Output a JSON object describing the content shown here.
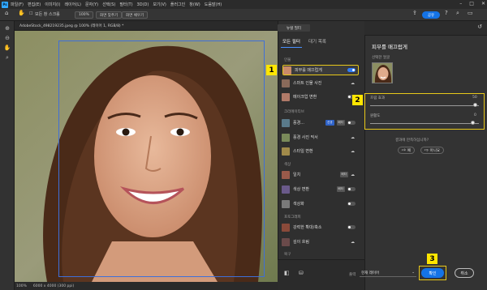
{
  "app": {
    "logo": "Ps",
    "menus": [
      "파일(F)",
      "편집(E)",
      "이미지(I)",
      "레이어(L)",
      "문자(Y)",
      "선택(S)",
      "필터(T)",
      "3D(D)",
      "보기(V)",
      "플러그인",
      "창(W)",
      "도움말(H)"
    ],
    "window_controls": [
      "–",
      "□",
      "✕"
    ]
  },
  "options_bar": {
    "scroll_all_label": "모든 창 스크롤",
    "zoom_value": "100%",
    "fit_screen_label": "화면 맞추기",
    "fill_screen_label": "화면 채우기",
    "share_label": "공유"
  },
  "document": {
    "tab_title": "AdobeStock_498219235.jpeg @ 100% (레이어 1, RGB/8) *"
  },
  "status": {
    "zoom": "100%",
    "info": "6000 x 4000 (300 ppi)"
  },
  "neural_filters": {
    "panel_title": "뉴럴 필터",
    "tabs": [
      "모든 필터",
      "대기 목록"
    ],
    "sections": {
      "portrait": "인물",
      "creative": "크리에이티브",
      "color": "색상",
      "photography": "포토그래피",
      "restoration": "복구"
    },
    "filters": {
      "skin_smoothing": "피부를 매끄럽게",
      "smart_portrait": "스마트 인물 사진",
      "makeup_transfer": "메이크업 변환",
      "landscape_mixer": "풍경...",
      "landscape_mixer_badge_beta": "베타",
      "landscape_mixer_badge_new": "신규",
      "photo_mixer": "풍경 사진 믹서",
      "style_transfer": "스타일 변환",
      "harmonization": "일치",
      "color_transfer": "색상 변환",
      "colorize": "색상화",
      "super_zoom": "강력한 확대/축소",
      "depth_blur": "깊이 흐림"
    },
    "badge_beta": "베타",
    "output_label": "출력",
    "output_value": "현재 레이어"
  },
  "right_panel": {
    "title": "피부를 매끄럽게",
    "selected_face_label": "선택한 얼굴",
    "blur_label": "흐림 효과",
    "blur_value": "50",
    "smoothness_label": "원활도",
    "smoothness_value": "0",
    "feedback_question": "결과에 만족하십니까?",
    "yes_label": "예",
    "no_label": "아니요",
    "ok_label": "확인",
    "cancel_label": "취소"
  },
  "callouts": [
    "1",
    "2",
    "3"
  ],
  "colors": {
    "accent": "#1473e6",
    "highlight": "#e8c81a",
    "callout": "#ffe600"
  }
}
